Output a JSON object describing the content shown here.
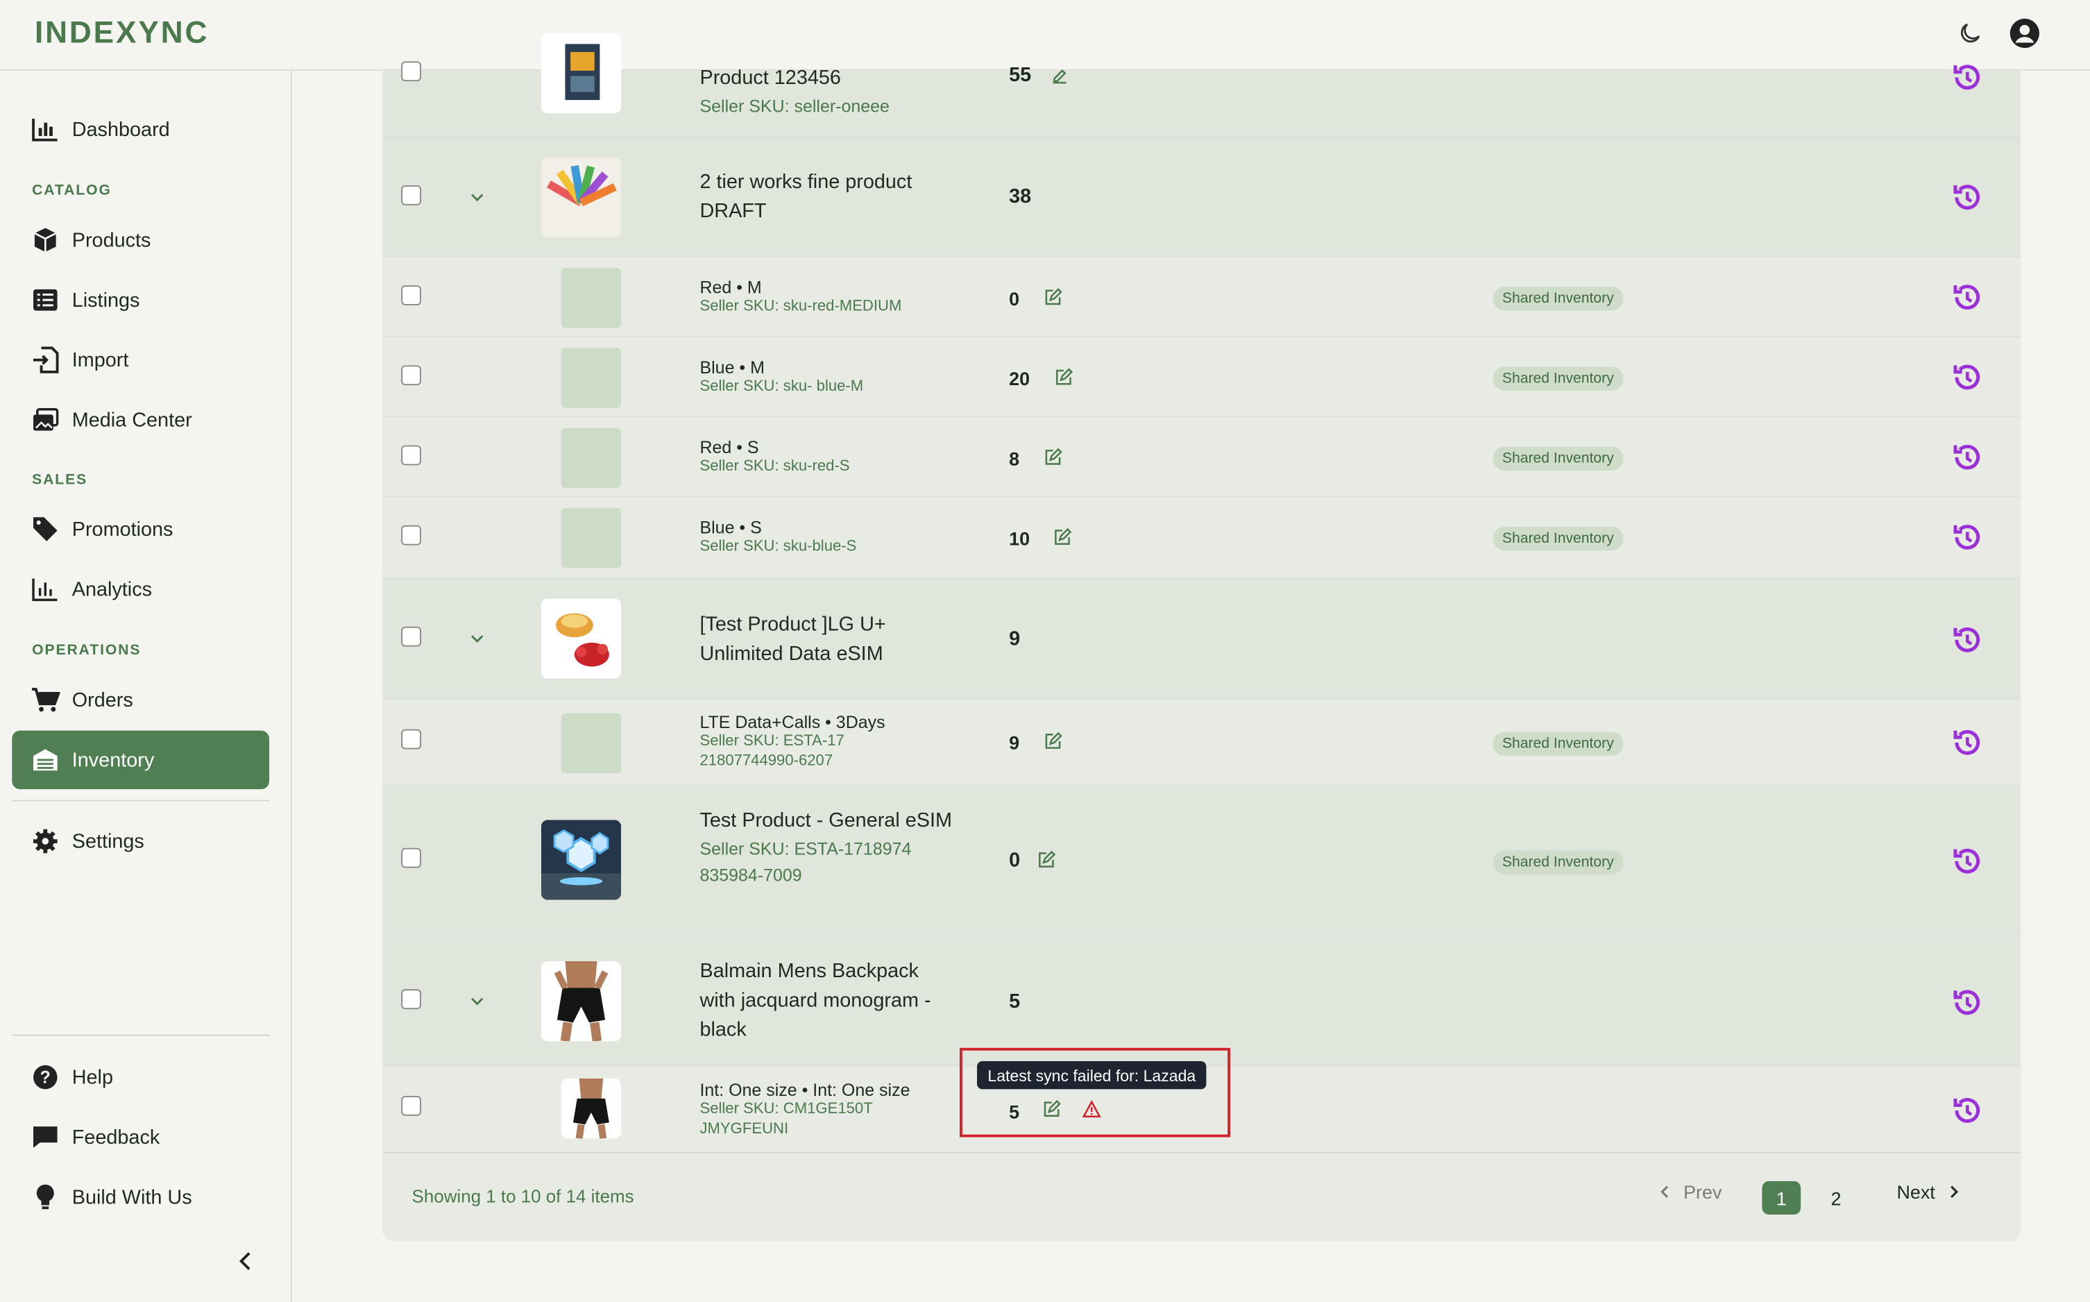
{
  "app": {
    "logo": "INDEXYNC"
  },
  "sidebar": {
    "items": [
      {
        "label": "Dashboard",
        "icon": "chart-bar-icon"
      },
      {
        "label": "Products",
        "icon": "box-icon"
      },
      {
        "label": "Listings",
        "icon": "list-icon"
      },
      {
        "label": "Import",
        "icon": "import-icon"
      },
      {
        "label": "Media Center",
        "icon": "images-icon"
      },
      {
        "label": "Promotions",
        "icon": "tag-icon"
      },
      {
        "label": "Analytics",
        "icon": "analytics-icon"
      },
      {
        "label": "Orders",
        "icon": "cart-icon"
      },
      {
        "label": "Inventory",
        "icon": "warehouse-icon"
      },
      {
        "label": "Settings",
        "icon": "gear-icon"
      },
      {
        "label": "Help",
        "icon": "help-icon"
      },
      {
        "label": "Feedback",
        "icon": "chat-icon"
      },
      {
        "label": "Build With Us",
        "icon": "lightbulb-icon"
      }
    ],
    "sections": {
      "catalog": "CATALOG",
      "sales": "SALES",
      "operations": "OPERATIONS"
    },
    "active": "Inventory"
  },
  "table": {
    "badge_label": "Shared Inventory",
    "rows": [
      {
        "type": "parent",
        "name": "Product 123456",
        "sku": "Seller SKU: seller-oneee",
        "qty": "55"
      },
      {
        "type": "parent",
        "name": "2 tier works fine product DRAFT",
        "qty": "38"
      },
      {
        "type": "child",
        "name": "Red • M",
        "sku": "Seller SKU: sku-red-MEDIUM",
        "qty": "0"
      },
      {
        "type": "child",
        "name": "Blue • M",
        "sku": "Seller SKU: sku- blue-M",
        "qty": "20"
      },
      {
        "type": "child",
        "name": "Red • S",
        "sku": "Seller SKU: sku-red-S",
        "qty": "8"
      },
      {
        "type": "child",
        "name": "Blue • S",
        "sku": "Seller SKU: sku-blue-S",
        "qty": "10"
      },
      {
        "type": "parent",
        "name": "[Test Product ]LG U+ Unlimited Data eSIM",
        "qty": "9"
      },
      {
        "type": "child",
        "name": "LTE Data+Calls • 3Days",
        "sku": "Seller SKU: ESTA-1721807744990-6207",
        "qty": "9"
      },
      {
        "type": "parent",
        "name": "Test Product - General eSIM",
        "sku": "Seller SKU: ESTA-1718974835984-7009",
        "qty": "0"
      },
      {
        "type": "parent",
        "name": "Balmain Mens Backpack with jacquard monogram - black",
        "qty": "5"
      },
      {
        "type": "child",
        "name": "Int: One size • Int: One size",
        "sku": "Seller SKU: CM1GE150TJMYGFEUNI",
        "qty": "5"
      }
    ],
    "tooltip": "Latest sync failed for: Lazada"
  },
  "pagination": {
    "summary": "Showing 1 to 10 of 14 items",
    "prev": "Prev",
    "next": "Next",
    "pages": [
      "1",
      "2"
    ],
    "current": "1"
  },
  "colors": {
    "accent": "#4f7f53",
    "history_icon": "#9b30d9",
    "error": "#d0222a"
  }
}
